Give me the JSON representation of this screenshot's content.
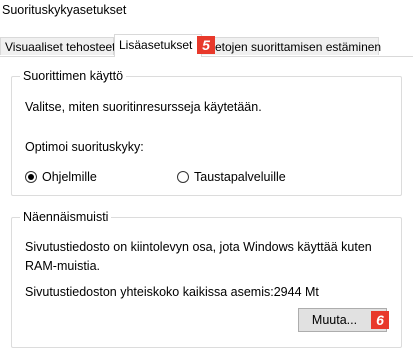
{
  "window": {
    "title": "Suorituskykyasetukset"
  },
  "tabs": [
    {
      "label": "Visuaaliset tehosteet"
    },
    {
      "label": "Lisäasetukset"
    },
    {
      "label": "Tietojen suorittamisen estäminen",
      "visible_text": "etojen suorittamisen estäminen"
    }
  ],
  "badges": {
    "tab_badge": "5",
    "button_badge": "6",
    "color": "#e8392b"
  },
  "processor_group": {
    "legend": "Suorittimen käyttö",
    "description": "Valitse, miten suoritinresursseja käytetään.",
    "optimize_label": "Optimoi suorituskyky:",
    "options": [
      {
        "label": "Ohjelmille",
        "selected": true
      },
      {
        "label": "Taustapalveluille",
        "selected": false
      }
    ]
  },
  "virtual_memory_group": {
    "legend": "Näennäismuisti",
    "description_line1": "Sivutustiedosto on kiintolevyn osa, jota Windows käyttää kuten",
    "description_line2": "RAM-muistia.",
    "total_size_label": "Sivutustiedoston yhteiskoko kaikissa asemis:",
    "total_size_value": "2944 Mt",
    "change_button": "Muuta..."
  }
}
